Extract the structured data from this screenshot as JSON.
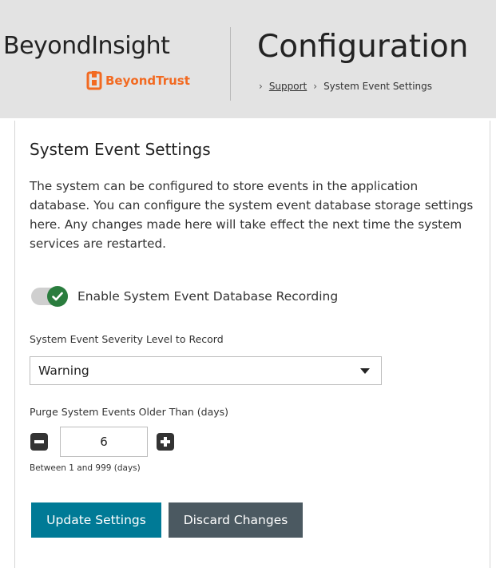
{
  "header": {
    "brand_title": "BeyondInsight",
    "logo_text": "BeyondTrust",
    "page_title": "Configuration",
    "breadcrumb": {
      "link": "Support",
      "current": "System Event Settings",
      "separator": "›"
    }
  },
  "panel": {
    "title": "System Event Settings",
    "description": "The system can be configured to store events in the application database. You can configure the system event database storage settings here. Any changes made here will take effect the next time the system services are restarted.",
    "toggle": {
      "label": "Enable System Event Database Recording",
      "enabled": true
    },
    "severity": {
      "label": "System Event Severity Level to Record",
      "value": "Warning"
    },
    "purge": {
      "label": "Purge System Events Older Than (days)",
      "value": "6",
      "hint": "Between 1 and 999 (days)"
    },
    "buttons": {
      "update": "Update Settings",
      "discard": "Discard Changes"
    }
  },
  "colors": {
    "accent": "#007a96",
    "secondary_button": "#4b5961",
    "toggle_on": "#2a7d3e",
    "logo": "#f26a21"
  }
}
